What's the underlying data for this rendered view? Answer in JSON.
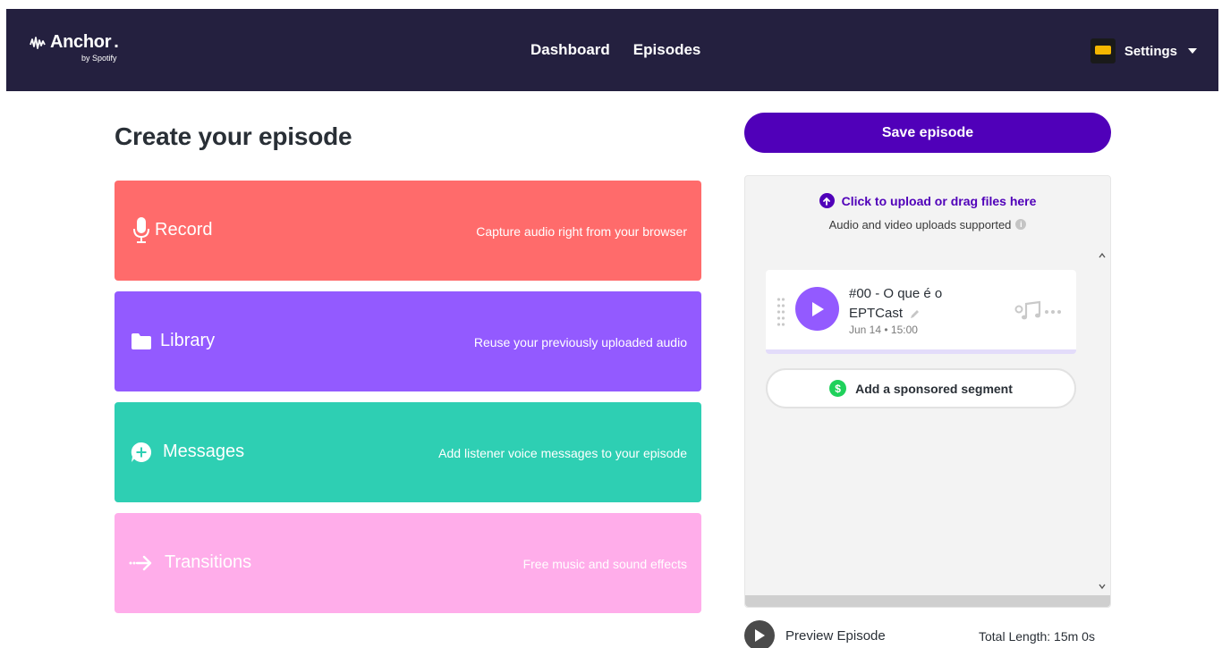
{
  "header": {
    "logo_text": "Anchor",
    "logo_sub": "by Spotify",
    "nav": [
      {
        "label": "Dashboard"
      },
      {
        "label": "Episodes"
      }
    ],
    "settings_label": "Settings"
  },
  "main": {
    "title": "Create your episode",
    "tiles": [
      {
        "label": "Record",
        "desc": "Capture audio right from your browser",
        "color": "#ff6b6b",
        "icon": "microphone-icon"
      },
      {
        "label": "Library",
        "desc": "Reuse your previously uploaded audio",
        "color": "#935aff",
        "icon": "folder-icon"
      },
      {
        "label": "Messages",
        "desc": "Add listener voice messages to your episode",
        "color": "#2ecfb3",
        "icon": "message-plus-icon"
      },
      {
        "label": "Transitions",
        "desc": "Free music and sound effects",
        "color": "#ffadea",
        "icon": "arrow-right-icon"
      }
    ]
  },
  "sidebar": {
    "save_label": "Save episode",
    "upload_label": "Click to upload or drag files here",
    "upload_hint": "Audio and video uploads supported",
    "info_glyph": "i",
    "episode": {
      "title_line1": "#00 - O que é o",
      "title_line2": "EPTCast",
      "date": "Jun 14 • 15:00"
    },
    "sponsor_label": "Add a sponsored segment",
    "sponsor_glyph": "$",
    "preview_label": "Preview Episode",
    "total_length": "Total Length: 15m 0s"
  },
  "colors": {
    "header_bg": "#24203f",
    "accent_purple": "#5000b9",
    "play_purple": "#935aff",
    "sponsor_green": "#1fd15b"
  }
}
